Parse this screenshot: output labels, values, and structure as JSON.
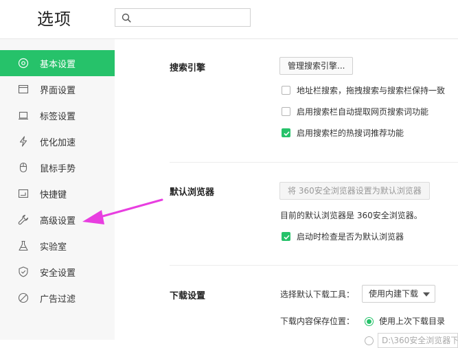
{
  "header": {
    "title": "选项",
    "search": {
      "value": "",
      "placeholder": "",
      "icon": "search-icon"
    }
  },
  "sidebar": {
    "accent_color": "#26c26a",
    "items": [
      {
        "label": "基本设置",
        "icon": "gear-icon",
        "active": true
      },
      {
        "label": "界面设置",
        "icon": "window-icon",
        "active": false
      },
      {
        "label": "标签设置",
        "icon": "tab-icon",
        "active": false
      },
      {
        "label": "优化加速",
        "icon": "lightning-icon",
        "active": false
      },
      {
        "label": "鼠标手势",
        "icon": "mouse-icon",
        "active": false
      },
      {
        "label": "快捷键",
        "icon": "keyboard-icon",
        "active": false
      },
      {
        "label": "高级设置",
        "icon": "wrench-icon",
        "active": false
      },
      {
        "label": "实验室",
        "icon": "flask-icon",
        "active": false
      },
      {
        "label": "安全设置",
        "icon": "shield-icon",
        "active": false
      },
      {
        "label": "广告过滤",
        "icon": "block-icon",
        "active": false
      }
    ]
  },
  "search_engine": {
    "title": "搜索引擎",
    "manage_button": "管理搜索引擎...",
    "options": [
      {
        "label": "地址栏搜索，拖拽搜索与搜索栏保持一致",
        "checked": false
      },
      {
        "label": "启用搜索栏自动提取网页搜索词功能",
        "checked": false
      },
      {
        "label": "启用搜索栏的热搜词推荐功能",
        "checked": true
      }
    ]
  },
  "default_browser": {
    "title": "默认浏览器",
    "set_default_button": "将 360安全浏览器设置为默认浏览器",
    "status": "目前的默认浏览器是 360安全浏览器。",
    "check_option": {
      "label": "启动时检查是否为默认浏览器",
      "checked": true
    }
  },
  "download": {
    "title": "下载设置",
    "tool_label": "选择默认下载工具：",
    "tool_selected": "使用内建下载",
    "location_label": "下载内容保存位置：",
    "location_option": {
      "label": "使用上次下载目录",
      "checked": true
    },
    "path_value": "D:\\360安全浏览器下载"
  },
  "annotation": {
    "arrow_color": "#e83ee0"
  }
}
